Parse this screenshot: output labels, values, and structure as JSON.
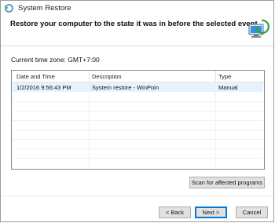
{
  "window": {
    "title": "System Restore",
    "heading": "Restore your computer to the state it was in before the selected event",
    "icon": "system-restore-icon"
  },
  "timezone": "Current time zone: GMT+7:00",
  "list": {
    "columns": [
      "Date and Time",
      "Description",
      "Type"
    ],
    "rows": [
      {
        "date": "1/2/2016 9:56:43 PM",
        "description": "System restore - WinPoin",
        "type": "Manual"
      }
    ]
  },
  "buttons": {
    "scan": "Scan for affected programs",
    "back": "< Back",
    "next": "Next >",
    "cancel": "Cancel"
  },
  "colors": {
    "selection": "#e5f3ff",
    "accent": "#0078d7"
  }
}
